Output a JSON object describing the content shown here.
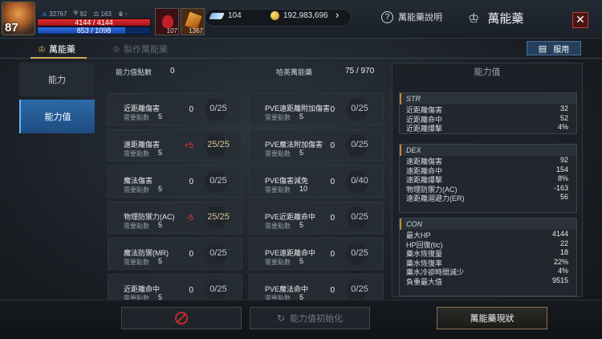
{
  "player": {
    "level": "87",
    "stat_a": "32767",
    "stat_b": "92",
    "stat_c": "163",
    "stat_d": "-",
    "hp": "4144 / 4144",
    "mp": "853 / 1098"
  },
  "quick_slots": [
    {
      "count": "107"
    },
    {
      "count": "1367"
    }
  ],
  "currency": {
    "gems": "104",
    "gold": "192,983,696"
  },
  "help_label": "萬能藥說明",
  "title": "萬能藥",
  "tabs": {
    "active": "萬能藥",
    "inactive": "製作萬能藥"
  },
  "use_button": "服用",
  "sidenav": [
    "能力",
    "能力值"
  ],
  "points": {
    "label": "能力值點數",
    "value": "0",
    "hsf_label": "哈英萬能藥",
    "hsf_value": "75 / 970"
  },
  "cards_left": [
    {
      "name": "近距離傷害",
      "req_label": "需要點數",
      "req": "5",
      "bonus": "0",
      "level": "0/25"
    },
    {
      "name": "遠距離傷害",
      "req_label": "需要點數",
      "req": "5",
      "bonus": "+5",
      "level": "25/25"
    },
    {
      "name": "魔法傷害",
      "req_label": "需要點數",
      "req": "5",
      "bonus": "0",
      "level": "0/25"
    },
    {
      "name": "物理防禦力(AC)",
      "req_label": "需要點數",
      "req": "5",
      "bonus": "-5",
      "level": "25/25"
    },
    {
      "name": "魔法防禦(MR)",
      "req_label": "需要點數",
      "req": "5",
      "bonus": "0",
      "level": "0/25"
    },
    {
      "name": "近距離命中",
      "req_label": "需要點數",
      "req": "5",
      "bonus": "0",
      "level": "0/25"
    }
  ],
  "cards_right": [
    {
      "name": "PVE遠距離附加傷害",
      "req_label": "需要點數",
      "req": "5",
      "bonus": "0",
      "level": "0/25"
    },
    {
      "name": "PVE魔法附加傷害",
      "req_label": "需要點數",
      "req": "5",
      "bonus": "0",
      "level": "0/25"
    },
    {
      "name": "PVE傷害減免",
      "req_label": "需要點數",
      "req": "10",
      "bonus": "0",
      "level": "0/40"
    },
    {
      "name": "PVE近距離命中",
      "req_label": "需要點數",
      "req": "5",
      "bonus": "0",
      "level": "0/25"
    },
    {
      "name": "PVE遠距離命中",
      "req_label": "需要點數",
      "req": "5",
      "bonus": "0",
      "level": "0/25"
    },
    {
      "name": "PVE魔法命中",
      "req_label": "需要點數",
      "req": "5",
      "bonus": "0",
      "level": "0/25"
    }
  ],
  "panel": {
    "title": "能力值",
    "str": {
      "title": "STR",
      "rows": [
        [
          "近距離傷害",
          "32"
        ],
        [
          "近距離命中",
          "52"
        ],
        [
          "近距離爆擊",
          "4%"
        ]
      ]
    },
    "dex": {
      "title": "DEX",
      "rows": [
        [
          "遠距離傷害",
          "92"
        ],
        [
          "遠距離命中",
          "154"
        ],
        [
          "遠距離爆擊",
          "8%"
        ],
        [
          "物理防禦力(AC)",
          "-163"
        ],
        [
          "遠距離迴避力(ER)",
          "56"
        ]
      ]
    },
    "con": {
      "title": "CON",
      "rows": [
        [
          "最大HP",
          "4144"
        ],
        [
          "HP回復(tic)",
          "22"
        ],
        [
          "藥水恢復量",
          "18"
        ],
        [
          "藥水恢復率",
          "22%"
        ],
        [
          "藥水冷卻時間減少",
          "4%"
        ],
        [
          "負重最大值",
          "9515"
        ]
      ]
    }
  },
  "bottom": {
    "reset": "能力值初始化",
    "status": "萬能藥現狀"
  },
  "colors": {
    "accent_gold": "#d3aa5a",
    "active_blue": "#2e6aa8",
    "hp_red": "#e02a30",
    "mp_blue": "#2a6de0"
  }
}
